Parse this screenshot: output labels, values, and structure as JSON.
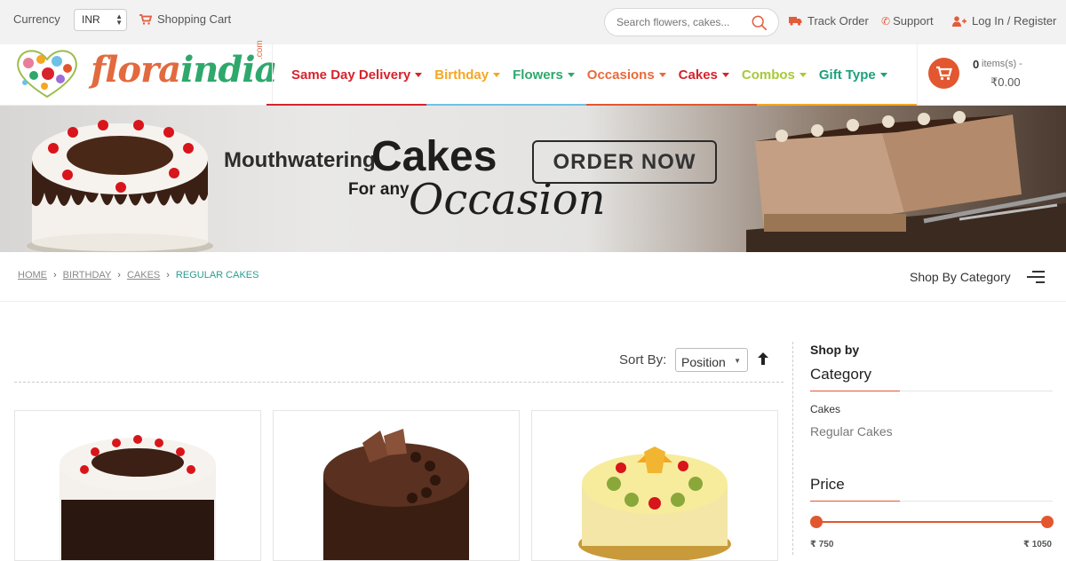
{
  "topbar": {
    "currency_label": "Currency",
    "currency_value": "INR",
    "cart_label": "Shopping Cart",
    "search_placeholder": "Search flowers, cakes...",
    "track_order": "Track Order",
    "support": "Support",
    "login": "Log In / Register"
  },
  "header": {
    "logo_main": "flora",
    "logo_accent": "india",
    "logo_suffix": ".com",
    "nav": [
      {
        "label": "Same Day Delivery",
        "color": "#d6232c"
      },
      {
        "label": "Birthday",
        "color": "#f5a623"
      },
      {
        "label": "Flowers",
        "color": "#2ea86b"
      },
      {
        "label": "Occasions",
        "color": "#e86a3c"
      },
      {
        "label": "Cakes",
        "color": "#d6232c"
      },
      {
        "label": "Combos",
        "color": "#a8c83a"
      },
      {
        "label": "Gift Type",
        "color": "#1ea07c"
      }
    ],
    "cart": {
      "count": "0",
      "items_label": "items(s) -",
      "total": "₹0.00"
    }
  },
  "banner": {
    "line1": "Mouthwatering",
    "line2": "Cakes",
    "line3": "For any",
    "line4": "Occasion",
    "cta": "ORDER NOW"
  },
  "breadcrumb": {
    "items": [
      "HOME",
      "BIRTHDAY",
      "CAKES"
    ],
    "current": "REGULAR CAKES"
  },
  "shop_by_category": "Shop By Category",
  "sort": {
    "label": "Sort By:",
    "value": "Position"
  },
  "sidebar": {
    "shop_by": "Shop by",
    "category_heading": "Category",
    "category_title": "Cakes",
    "category_item": "Regular Cakes",
    "price_heading": "Price",
    "price_min": "₹ 750",
    "price_max": "₹ 1050"
  },
  "products": [
    {
      "icon": "black-forest-cake"
    },
    {
      "icon": "chocolate-cake"
    },
    {
      "icon": "fruit-cake"
    }
  ]
}
